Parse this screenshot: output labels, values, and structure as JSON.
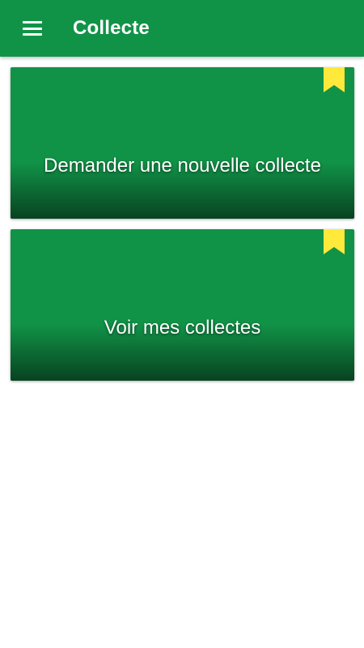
{
  "colors": {
    "primary": "#119347",
    "ribbon": "#FFE93B",
    "text": "#ffffff"
  },
  "appbar": {
    "menu_icon": "hamburger-menu-icon",
    "title": "Collecte"
  },
  "cards": [
    {
      "label": "Demander une nouvelle collecte",
      "icon": "bookmark-ribbon-icon"
    },
    {
      "label": "Voir mes collectes",
      "icon": "bookmark-ribbon-icon"
    }
  ]
}
